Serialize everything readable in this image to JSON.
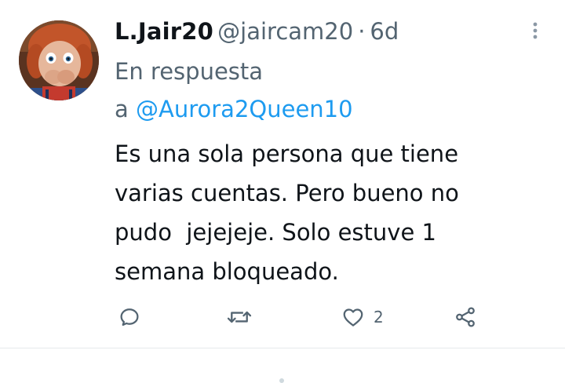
{
  "tweet": {
    "author": {
      "name": "L.Jair20",
      "handle": "@jaircam20",
      "separator": "·",
      "time": "6d",
      "avatar": "chucky-doll-avatar"
    },
    "reply_prefix": "En respuesta",
    "reply_connector": "a",
    "reply_to": "@Aurora2Queen10",
    "body_lines": [
      "Es una sola persona que tiene",
      "varias cuentas. Pero bueno no",
      "pudo  jejejeje. Solo estuve 1",
      "semana bloqueado."
    ],
    "actions": {
      "reply": {
        "icon": "reply-icon",
        "count": ""
      },
      "retweet": {
        "icon": "retweet-icon",
        "count": ""
      },
      "like": {
        "icon": "heart-icon",
        "count": "2"
      },
      "share": {
        "icon": "share-icon",
        "count": ""
      }
    },
    "more_icon": "more-vertical-icon"
  },
  "colors": {
    "primary_text": "#0f1419",
    "secondary_text": "#536471",
    "link": "#1d9bf0",
    "divider": "#e6e9eb"
  }
}
